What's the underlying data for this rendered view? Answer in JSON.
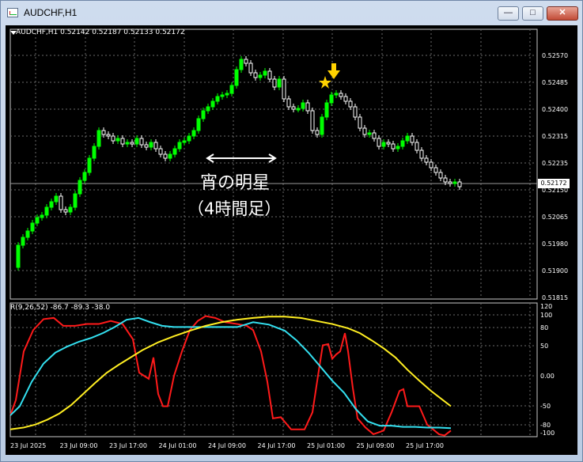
{
  "window": {
    "title": "AUDCHF,H1",
    "min_label": "—",
    "max_label": "□",
    "close_label": "✕"
  },
  "chart": {
    "symbol_info": "AUDCHF,H1  0.52142 0.52187 0.52133 0.52172",
    "current_price": "0.52172",
    "price_labels": [
      "0.52570",
      "0.52485",
      "0.52400",
      "0.52315",
      "0.52235",
      "0.52150",
      "0.52065",
      "0.51980",
      "0.51900",
      "0.51815"
    ],
    "indicator_info": "R(9,26,52) -86.7 -89.3 -38.0",
    "indicator_labels": [
      "120",
      "100",
      "80",
      "50",
      "0.00",
      "-50",
      "-80",
      "-100"
    ],
    "time_labels": [
      "23 Jul 2025",
      "23 Jul 09:00",
      "23 Jul 17:00",
      "24 Jul 01:00",
      "24 Jul 09:00",
      "24 Jul 17:00",
      "25 Jul 01:00",
      "25 Jul 09:00",
      "25 Jul 17:00"
    ],
    "annotation_title": "宵の明星",
    "annotation_sub": "（4時間足）",
    "colors": {
      "bull": "#00ff00",
      "bear": "#ffffff",
      "red_line": "#ff1a1a",
      "cyan_line": "#33e0f0",
      "yellow_line": "#ffee22",
      "marker": "#ffd200"
    }
  }
}
